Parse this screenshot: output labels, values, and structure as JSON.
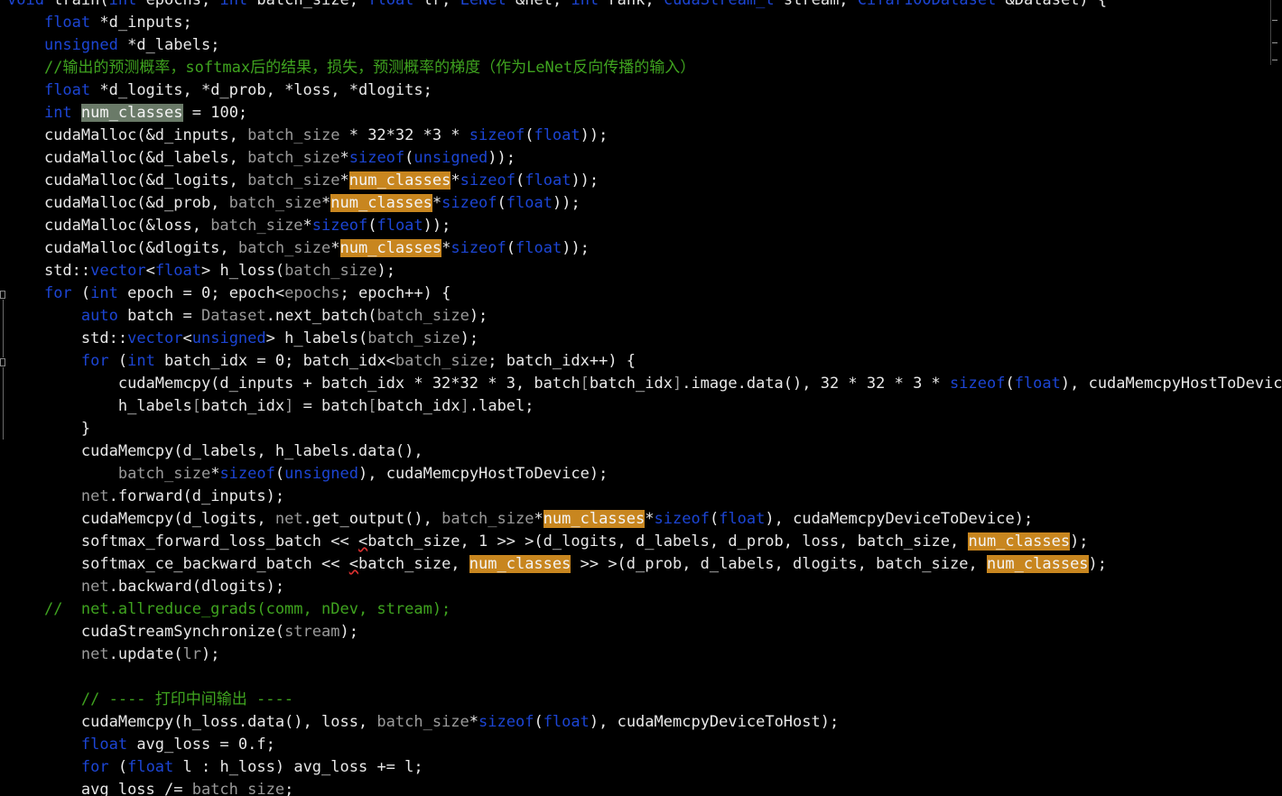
{
  "editor": {
    "lines": [
      {
        "indent": 0,
        "spans": [
          [
            "kw",
            "void"
          ],
          [
            "t",
            " train("
          ],
          [
            "kw",
            "int"
          ],
          [
            "t",
            " epochs, "
          ],
          [
            "kw",
            "int"
          ],
          [
            "t",
            " batch_size, "
          ],
          [
            "kw",
            "float"
          ],
          [
            "t",
            " lr, "
          ],
          [
            "kw",
            "LeNet"
          ],
          [
            "t",
            " &net, "
          ],
          [
            "kw",
            "int"
          ],
          [
            "t",
            " rank, "
          ],
          [
            "kw",
            "cudaStream_t"
          ],
          [
            "t",
            " stream, "
          ],
          [
            "kw",
            "Cifar100Dataset"
          ],
          [
            "t",
            " &Dataset) {"
          ]
        ]
      },
      {
        "indent": 1,
        "spans": [
          [
            "kw",
            "float"
          ],
          [
            "t",
            " *d_inputs;"
          ]
        ]
      },
      {
        "indent": 1,
        "spans": [
          [
            "kw",
            "unsigned"
          ],
          [
            "t",
            " *d_labels;"
          ]
        ]
      },
      {
        "indent": 1,
        "spans": [
          [
            "cm",
            "//输出的预测概率，softmax后的结果，损失，预测概率的梯度（作为LeNet反向传播的输入）"
          ]
        ]
      },
      {
        "indent": 1,
        "spans": [
          [
            "kw",
            "float"
          ],
          [
            "t",
            " *d_logits, *d_prob, *loss, *dlogits;"
          ]
        ]
      },
      {
        "indent": 1,
        "spans": [
          [
            "kw",
            "int"
          ],
          [
            "t",
            " "
          ],
          [
            "hl2",
            "num_classes"
          ],
          [
            "t",
            " = 100;"
          ]
        ]
      },
      {
        "indent": 1,
        "spans": [
          [
            "t",
            "cudaMalloc(&d_inputs, "
          ],
          [
            "dim",
            "batch_size"
          ],
          [
            "t",
            " * 32*32 *3 * "
          ],
          [
            "kw",
            "sizeof"
          ],
          [
            "t",
            "("
          ],
          [
            "kw",
            "float"
          ],
          [
            "t",
            "));"
          ]
        ]
      },
      {
        "indent": 1,
        "spans": [
          [
            "t",
            "cudaMalloc(&d_labels, "
          ],
          [
            "dim",
            "batch_size"
          ],
          [
            "t",
            "*"
          ],
          [
            "kw",
            "sizeof"
          ],
          [
            "t",
            "("
          ],
          [
            "kw",
            "unsigned"
          ],
          [
            "t",
            "));"
          ]
        ]
      },
      {
        "indent": 1,
        "spans": [
          [
            "t",
            "cudaMalloc(&d_logits, "
          ],
          [
            "dim",
            "batch_size"
          ],
          [
            "t",
            "*"
          ],
          [
            "hl",
            "num_classes"
          ],
          [
            "t",
            "*"
          ],
          [
            "kw",
            "sizeof"
          ],
          [
            "t",
            "("
          ],
          [
            "kw",
            "float"
          ],
          [
            "t",
            "));"
          ]
        ]
      },
      {
        "indent": 1,
        "spans": [
          [
            "t",
            "cudaMalloc(&d_prob, "
          ],
          [
            "dim",
            "batch_size"
          ],
          [
            "t",
            "*"
          ],
          [
            "hl",
            "num_classes"
          ],
          [
            "t",
            "*"
          ],
          [
            "kw",
            "sizeof"
          ],
          [
            "t",
            "("
          ],
          [
            "kw",
            "float"
          ],
          [
            "t",
            "));"
          ]
        ]
      },
      {
        "indent": 1,
        "spans": [
          [
            "t",
            "cudaMalloc(&loss, "
          ],
          [
            "dim",
            "batch_size"
          ],
          [
            "t",
            "*"
          ],
          [
            "kw",
            "sizeof"
          ],
          [
            "t",
            "("
          ],
          [
            "kw",
            "float"
          ],
          [
            "t",
            "));"
          ]
        ]
      },
      {
        "indent": 1,
        "spans": [
          [
            "t",
            "cudaMalloc(&dlogits, "
          ],
          [
            "dim",
            "batch_size"
          ],
          [
            "t",
            "*"
          ],
          [
            "hl",
            "num_classes"
          ],
          [
            "t",
            "*"
          ],
          [
            "kw",
            "sizeof"
          ],
          [
            "t",
            "("
          ],
          [
            "kw",
            "float"
          ],
          [
            "t",
            "));"
          ]
        ]
      },
      {
        "indent": 1,
        "spans": [
          [
            "t",
            "std::"
          ],
          [
            "kw",
            "vector"
          ],
          [
            "t",
            "<"
          ],
          [
            "kw",
            "float"
          ],
          [
            "t",
            "> h_loss("
          ],
          [
            "dim",
            "batch_size"
          ],
          [
            "t",
            ");"
          ]
        ]
      },
      {
        "indent": 1,
        "spans": [
          [
            "kw",
            "for"
          ],
          [
            "t",
            " ("
          ],
          [
            "kw",
            "int"
          ],
          [
            "t",
            " epoch = 0; epoch<"
          ],
          [
            "dim",
            "epochs"
          ],
          [
            "t",
            "; epoch++) {"
          ]
        ]
      },
      {
        "indent": 2,
        "spans": [
          [
            "kw",
            "auto"
          ],
          [
            "t",
            " batch = "
          ],
          [
            "dim",
            "Dataset"
          ],
          [
            "t",
            ".next_batch("
          ],
          [
            "dim",
            "batch_size"
          ],
          [
            "t",
            ");"
          ]
        ]
      },
      {
        "indent": 2,
        "spans": [
          [
            "t",
            "std::"
          ],
          [
            "kw",
            "vector"
          ],
          [
            "t",
            "<"
          ],
          [
            "kw",
            "unsigned"
          ],
          [
            "t",
            "> h_labels("
          ],
          [
            "dim",
            "batch_size"
          ],
          [
            "t",
            ");"
          ]
        ]
      },
      {
        "indent": 2,
        "spans": [
          [
            "kw",
            "for"
          ],
          [
            "t",
            " ("
          ],
          [
            "kw",
            "int"
          ],
          [
            "t",
            " batch_idx = 0; batch_idx<"
          ],
          [
            "dim",
            "batch_size"
          ],
          [
            "t",
            "; batch_idx++) {"
          ]
        ]
      },
      {
        "indent": 3,
        "spans": [
          [
            "t",
            "cudaMemcpy(d_inputs + batch_idx * 32*32 * 3, batch"
          ],
          [
            "dim",
            "["
          ],
          [
            "t",
            "batch_idx"
          ],
          [
            "dim",
            "]"
          ],
          [
            "t",
            ".image.data(), 32 * 32 * 3 * "
          ],
          [
            "kw",
            "sizeof"
          ],
          [
            "t",
            "("
          ],
          [
            "kw",
            "float"
          ],
          [
            "t",
            "), cudaMemcpyHostToDevice);"
          ]
        ]
      },
      {
        "indent": 3,
        "spans": [
          [
            "t",
            "h_labels"
          ],
          [
            "dim",
            "["
          ],
          [
            "t",
            "batch_idx"
          ],
          [
            "dim",
            "]"
          ],
          [
            "t",
            " = batch"
          ],
          [
            "dim",
            "["
          ],
          [
            "t",
            "batch_idx"
          ],
          [
            "dim",
            "]"
          ],
          [
            "t",
            ".label;"
          ]
        ]
      },
      {
        "indent": 2,
        "spans": [
          [
            "t",
            "}"
          ]
        ]
      },
      {
        "indent": 2,
        "spans": [
          [
            "t",
            "cudaMemcpy(d_labels, h_labels.data(),"
          ]
        ]
      },
      {
        "indent": 3,
        "spans": [
          [
            "dim",
            "batch_size"
          ],
          [
            "t",
            "*"
          ],
          [
            "kw",
            "sizeof"
          ],
          [
            "t",
            "("
          ],
          [
            "kw",
            "unsigned"
          ],
          [
            "t",
            "), cudaMemcpyHostToDevice);"
          ]
        ]
      },
      {
        "indent": 2,
        "spans": [
          [
            "dim",
            "net"
          ],
          [
            "t",
            ".forward(d_inputs);"
          ]
        ]
      },
      {
        "indent": 2,
        "spans": [
          [
            "t",
            "cudaMemcpy(d_logits, "
          ],
          [
            "dim",
            "net"
          ],
          [
            "t",
            ".get_output(), "
          ],
          [
            "dim",
            "batch_size"
          ],
          [
            "t",
            "*"
          ],
          [
            "hl",
            "num_classes"
          ],
          [
            "t",
            "*"
          ],
          [
            "kw",
            "sizeof"
          ],
          [
            "t",
            "("
          ],
          [
            "kw",
            "float"
          ],
          [
            "t",
            "), cudaMemcpyDeviceToDevice);"
          ]
        ]
      },
      {
        "indent": 2,
        "spans": [
          [
            "t",
            "softmax_forward_loss_batch << "
          ],
          [
            "sq",
            "<"
          ],
          [
            "t",
            "batch_size, 1 >> >(d_logits, d_labels, d_prob, loss, batch_size, "
          ],
          [
            "hl",
            "num_classes"
          ],
          [
            "t",
            ");"
          ]
        ]
      },
      {
        "indent": 2,
        "spans": [
          [
            "t",
            "softmax_ce_backward_batch << "
          ],
          [
            "sq",
            "<"
          ],
          [
            "t",
            "batch_size, "
          ],
          [
            "hl",
            "num_classes"
          ],
          [
            "t",
            " >> >(d_prob, d_labels, dlogits, batch_size, "
          ],
          [
            "hl",
            "num_classes"
          ],
          [
            "t",
            ");"
          ]
        ]
      },
      {
        "indent": 2,
        "spans": [
          [
            "dim",
            "net"
          ],
          [
            "t",
            ".backward(dlogits);"
          ]
        ]
      },
      {
        "indent": 1,
        "spans": [
          [
            "cm",
            "//  net.allreduce_grads(comm, nDev, stream);"
          ]
        ]
      },
      {
        "indent": 2,
        "spans": [
          [
            "t",
            "cudaStreamSynchronize("
          ],
          [
            "dim",
            "stream"
          ],
          [
            "t",
            ");"
          ]
        ]
      },
      {
        "indent": 2,
        "spans": [
          [
            "dim",
            "net"
          ],
          [
            "t",
            ".update("
          ],
          [
            "dim",
            "lr"
          ],
          [
            "t",
            ");"
          ]
        ]
      },
      {
        "indent": 0,
        "spans": []
      },
      {
        "indent": 2,
        "spans": [
          [
            "cm",
            "// ---- 打印中间输出 ----"
          ]
        ]
      },
      {
        "indent": 2,
        "spans": [
          [
            "t",
            "cudaMemcpy(h_loss.data(), loss, "
          ],
          [
            "dim",
            "batch_size"
          ],
          [
            "t",
            "*"
          ],
          [
            "kw",
            "sizeof"
          ],
          [
            "t",
            "("
          ],
          [
            "kw",
            "float"
          ],
          [
            "t",
            "), cudaMemcpyDeviceToHost);"
          ]
        ]
      },
      {
        "indent": 2,
        "spans": [
          [
            "kw",
            "float"
          ],
          [
            "t",
            " avg_loss = 0.f;"
          ]
        ]
      },
      {
        "indent": 2,
        "spans": [
          [
            "kw",
            "for"
          ],
          [
            "t",
            " ("
          ],
          [
            "kw",
            "float"
          ],
          [
            "t",
            " l : h_loss) avg_loss += l;"
          ]
        ]
      },
      {
        "indent": 2,
        "spans": [
          [
            "t",
            "avg_loss /= "
          ],
          [
            "dim",
            "batch_size"
          ],
          [
            "t",
            ";"
          ]
        ]
      }
    ]
  },
  "colors": {
    "background": "#000000",
    "text": "#e8e8e8",
    "keyword": "#1c45d4",
    "comment": "#3fa31f",
    "identifier_dim": "#9a9a9a",
    "highlight": "#c8861f",
    "highlight_selected": "#6a7a68"
  },
  "icons": [
    "fold-toggle-icon"
  ]
}
